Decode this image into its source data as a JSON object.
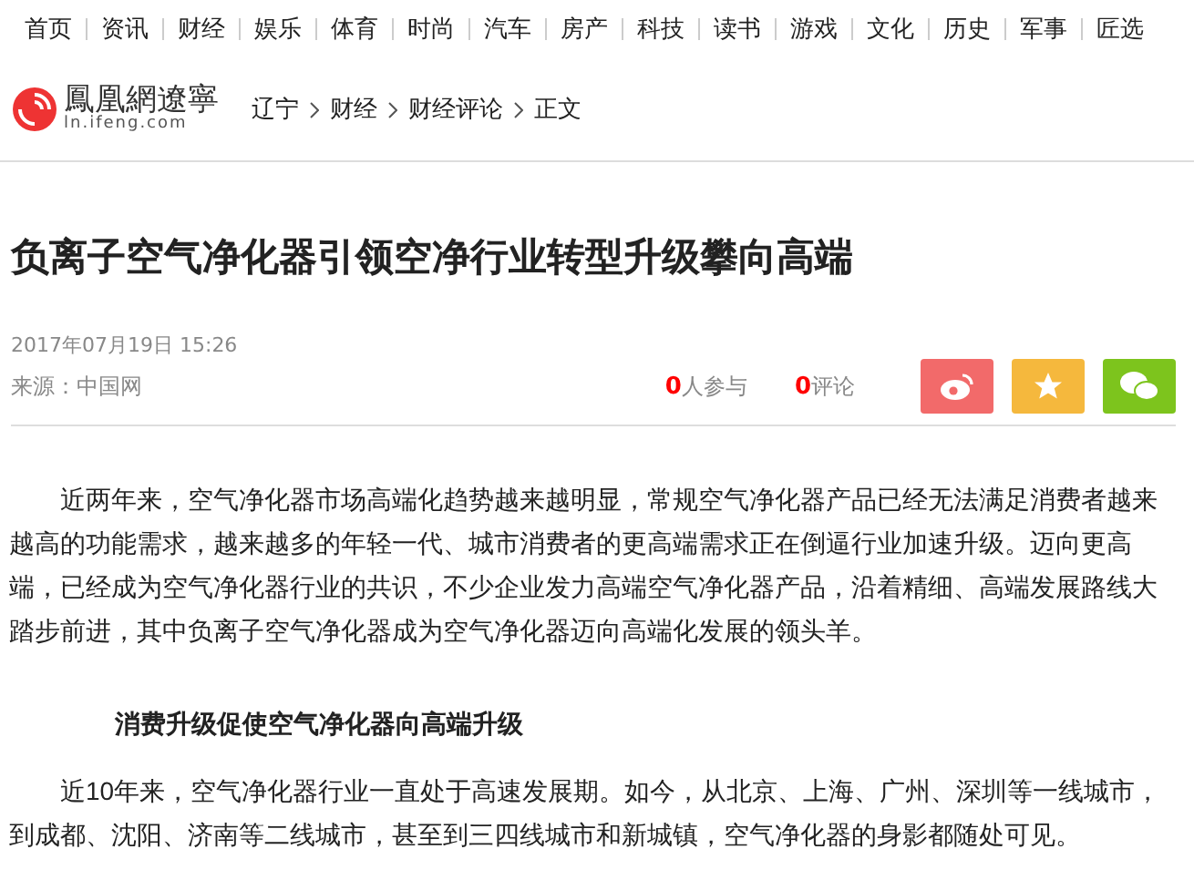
{
  "nav": [
    "首页",
    "资讯",
    "财经",
    "娱乐",
    "体育",
    "时尚",
    "汽车",
    "房产",
    "科技",
    "读书",
    "游戏",
    "文化",
    "历史",
    "军事",
    "匠选"
  ],
  "logo": {
    "name": "鳳凰網遼寧",
    "domain": "ln.ifeng.com"
  },
  "breadcrumb": [
    "辽宁",
    "财经",
    "财经评论",
    "正文"
  ],
  "title": "负离子空气净化器引领空净行业转型升级攀向高端",
  "date": "2017年07月19日  15:26",
  "source": "来源：中国网",
  "participants": {
    "count": "0",
    "label": "人参与"
  },
  "comments": {
    "count": "0",
    "label": "评论"
  },
  "share": [
    {
      "kind": "weibo"
    },
    {
      "kind": "favorite"
    },
    {
      "kind": "wechat"
    }
  ],
  "body": [
    {
      "kind": "paragraph",
      "text": "近两年来，空气净化器市场高端化趋势越来越明显，常规空气净化器产品已经无法满足消费者越来越高的功能需求，越来越多的年轻一代、城市消费者的更高端需求正在倒逼行业加速升级。迈向更高端，已经成为空气净化器行业的共识，不少企业发力高端空气净化器产品，沿着精细、高端发展路线大踏步前进，其中负离子空气净化器成为空气净化器迈向高端化发展的领头羊。"
    },
    {
      "kind": "heading",
      "text": "消费升级促使空气净化器向高端升级"
    },
    {
      "kind": "paragraph",
      "text": "近10年来，空气净化器行业一直处于高速发展期。如今，从北京、上海、广州、深圳等一线城市，到成都、沈阳、济南等二线城市，甚至到三四线城市和新城镇，空气净化器的身影都随处可见。"
    }
  ]
}
